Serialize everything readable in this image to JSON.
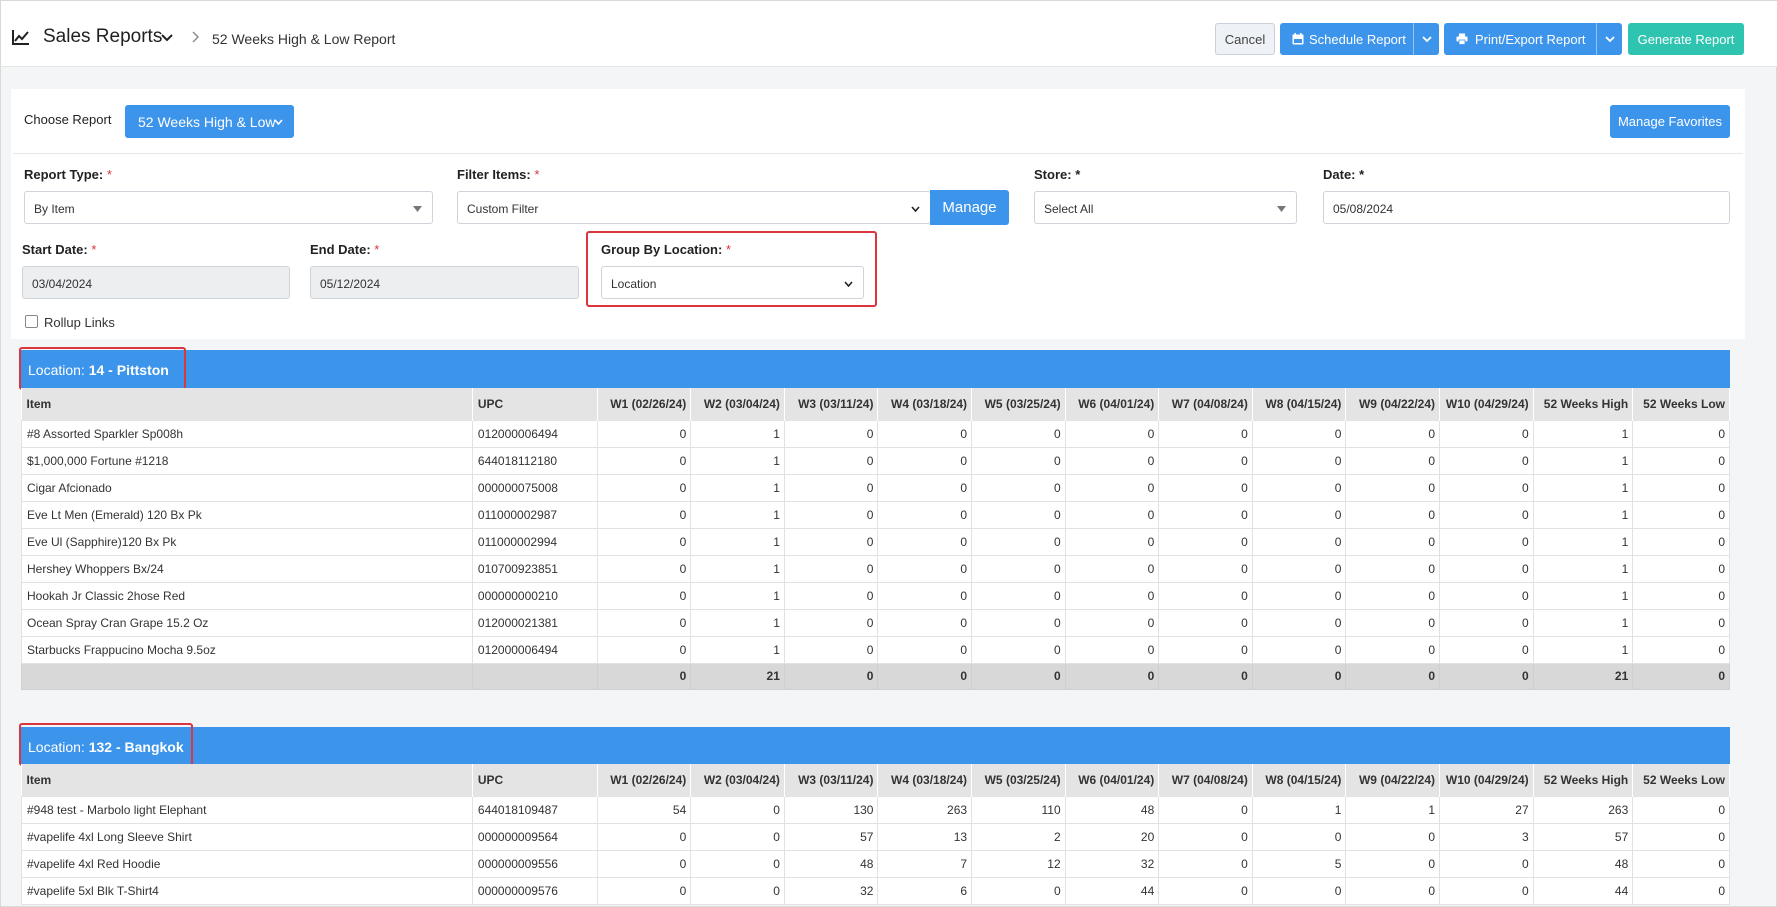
{
  "header": {
    "title": "Sales Reports",
    "breadcrumb": "52 Weeks High & Low Report",
    "cancel_label": "Cancel",
    "schedule_label": "Schedule Report",
    "print_label": "Print/Export Report",
    "generate_label": "Generate Report"
  },
  "choose": {
    "label": "Choose Report",
    "selected": "52 Weeks High & Low",
    "favorites_label": "Manage Favorites"
  },
  "filters": {
    "report_type": {
      "label": "Report Type:",
      "value": "By Item"
    },
    "filter_items": {
      "label": "Filter Items:",
      "value": "Custom Filter",
      "manage_label": "Manage"
    },
    "store": {
      "label": "Store:",
      "value": "Select All"
    },
    "date": {
      "label": "Date:",
      "value": "05/08/2024"
    },
    "start_date": {
      "label": "Start Date:",
      "value": "03/04/2024"
    },
    "end_date": {
      "label": "End Date:",
      "value": "05/12/2024"
    },
    "group_by": {
      "label": "Group By Location:",
      "value": "Location"
    },
    "rollup_label": "Rollup Links",
    "required_mark": "*"
  },
  "columns": [
    "Item",
    "UPC",
    "W1 (02/26/24)",
    "W2 (03/04/24)",
    "W3 (03/11/24)",
    "W4 (03/18/24)",
    "W5 (03/25/24)",
    "W6 (04/01/24)",
    "W7 (04/08/24)",
    "W8 (04/15/24)",
    "W9 (04/22/24)",
    "W10 (04/29/24)",
    "52 Weeks High",
    "52 Weeks Low"
  ],
  "locations": [
    {
      "prefix": "Location: ",
      "name": "14 - Pittston",
      "rows": [
        [
          "#8 Assorted Sparkler Sp008h",
          "012000006494",
          "0",
          "1",
          "0",
          "0",
          "0",
          "0",
          "0",
          "0",
          "0",
          "0",
          "1",
          "0"
        ],
        [
          "$1,000,000 Fortune #1218",
          "644018112180",
          "0",
          "1",
          "0",
          "0",
          "0",
          "0",
          "0",
          "0",
          "0",
          "0",
          "1",
          "0"
        ],
        [
          "Cigar Afcionado",
          "000000075008",
          "0",
          "1",
          "0",
          "0",
          "0",
          "0",
          "0",
          "0",
          "0",
          "0",
          "1",
          "0"
        ],
        [
          "Eve Lt Men (Emerald) 120 Bx Pk",
          "011000002987",
          "0",
          "1",
          "0",
          "0",
          "0",
          "0",
          "0",
          "0",
          "0",
          "0",
          "1",
          "0"
        ],
        [
          "Eve Ul (Sapphire)120 Bx Pk",
          "011000002994",
          "0",
          "1",
          "0",
          "0",
          "0",
          "0",
          "0",
          "0",
          "0",
          "0",
          "1",
          "0"
        ],
        [
          "Hershey Whoppers Bx/24",
          "010700923851",
          "0",
          "1",
          "0",
          "0",
          "0",
          "0",
          "0",
          "0",
          "0",
          "0",
          "1",
          "0"
        ],
        [
          "Hookah Jr Classic 2hose Red",
          "000000000210",
          "0",
          "1",
          "0",
          "0",
          "0",
          "0",
          "0",
          "0",
          "0",
          "0",
          "1",
          "0"
        ],
        [
          "Ocean Spray Cran Grape 15.2 Oz",
          "012000021381",
          "0",
          "1",
          "0",
          "0",
          "0",
          "0",
          "0",
          "0",
          "0",
          "0",
          "1",
          "0"
        ],
        [
          "Starbucks Frappucino Mocha 9.5oz",
          "012000006494",
          "0",
          "1",
          "0",
          "0",
          "0",
          "0",
          "0",
          "0",
          "0",
          "0",
          "1",
          "0"
        ]
      ],
      "totals": [
        "",
        "",
        "0",
        "21",
        "0",
        "0",
        "0",
        "0",
        "0",
        "0",
        "0",
        "0",
        "21",
        "0"
      ]
    },
    {
      "prefix": "Location: ",
      "name": "132 - Bangkok",
      "rows": [
        [
          "#948 test - Marbolo light Elephant",
          "644018109487",
          "54",
          "0",
          "130",
          "263",
          "110",
          "48",
          "0",
          "1",
          "1",
          "27",
          "263",
          "0"
        ],
        [
          "#vapelife 4xl Long Sleeve Shirt",
          "000000009564",
          "0",
          "0",
          "57",
          "13",
          "2",
          "20",
          "0",
          "0",
          "0",
          "3",
          "57",
          "0"
        ],
        [
          "#vapelife 4xl Red Hoodie",
          "000000009556",
          "0",
          "0",
          "48",
          "7",
          "12",
          "32",
          "0",
          "5",
          "0",
          "0",
          "48",
          "0"
        ],
        [
          "#vapelife 5xl Blk T-Shirt4",
          "000000009576",
          "0",
          "0",
          "32",
          "6",
          "0",
          "44",
          "0",
          "0",
          "0",
          "0",
          "44",
          "0"
        ]
      ],
      "totals": null
    }
  ],
  "colors": {
    "accent": "#3d94eb",
    "generate": "#2ec4b0",
    "highlight": "#d9363e"
  }
}
